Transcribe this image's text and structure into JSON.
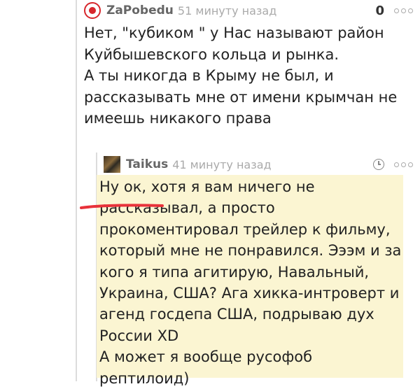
{
  "comment": {
    "author": "ZaPobedu",
    "time": "51 минуту назад",
    "rating": "0",
    "lines": [
      "Нет, \"кубиком \" у Нас называют район",
      "Куйбышевского кольца и рынка.",
      "А ты никогда в Крыму не был, и",
      "рассказывать мне от имени крымчан не",
      "имеешь никакого права"
    ]
  },
  "reply": {
    "author": "Taikus",
    "time": "41 минуту назад",
    "lines": [
      "Ну ок, хотя я вам ничего не",
      "рассказывал, а просто",
      "прокоментировал трейлер к фильму,",
      "который мне не понравился. Эээм и за",
      "кого я типа агитирую, Навальный,",
      "Украина, США? Ага хикка-интроверт и",
      "агенд госдепа США, подрываю дух",
      "России XD",
      "А может я вообще русофоб рептилоид)"
    ]
  },
  "colors": {
    "highlight": "#fbf5d2",
    "underline": "#e8323a",
    "avatar_ring": "#d7262c"
  }
}
